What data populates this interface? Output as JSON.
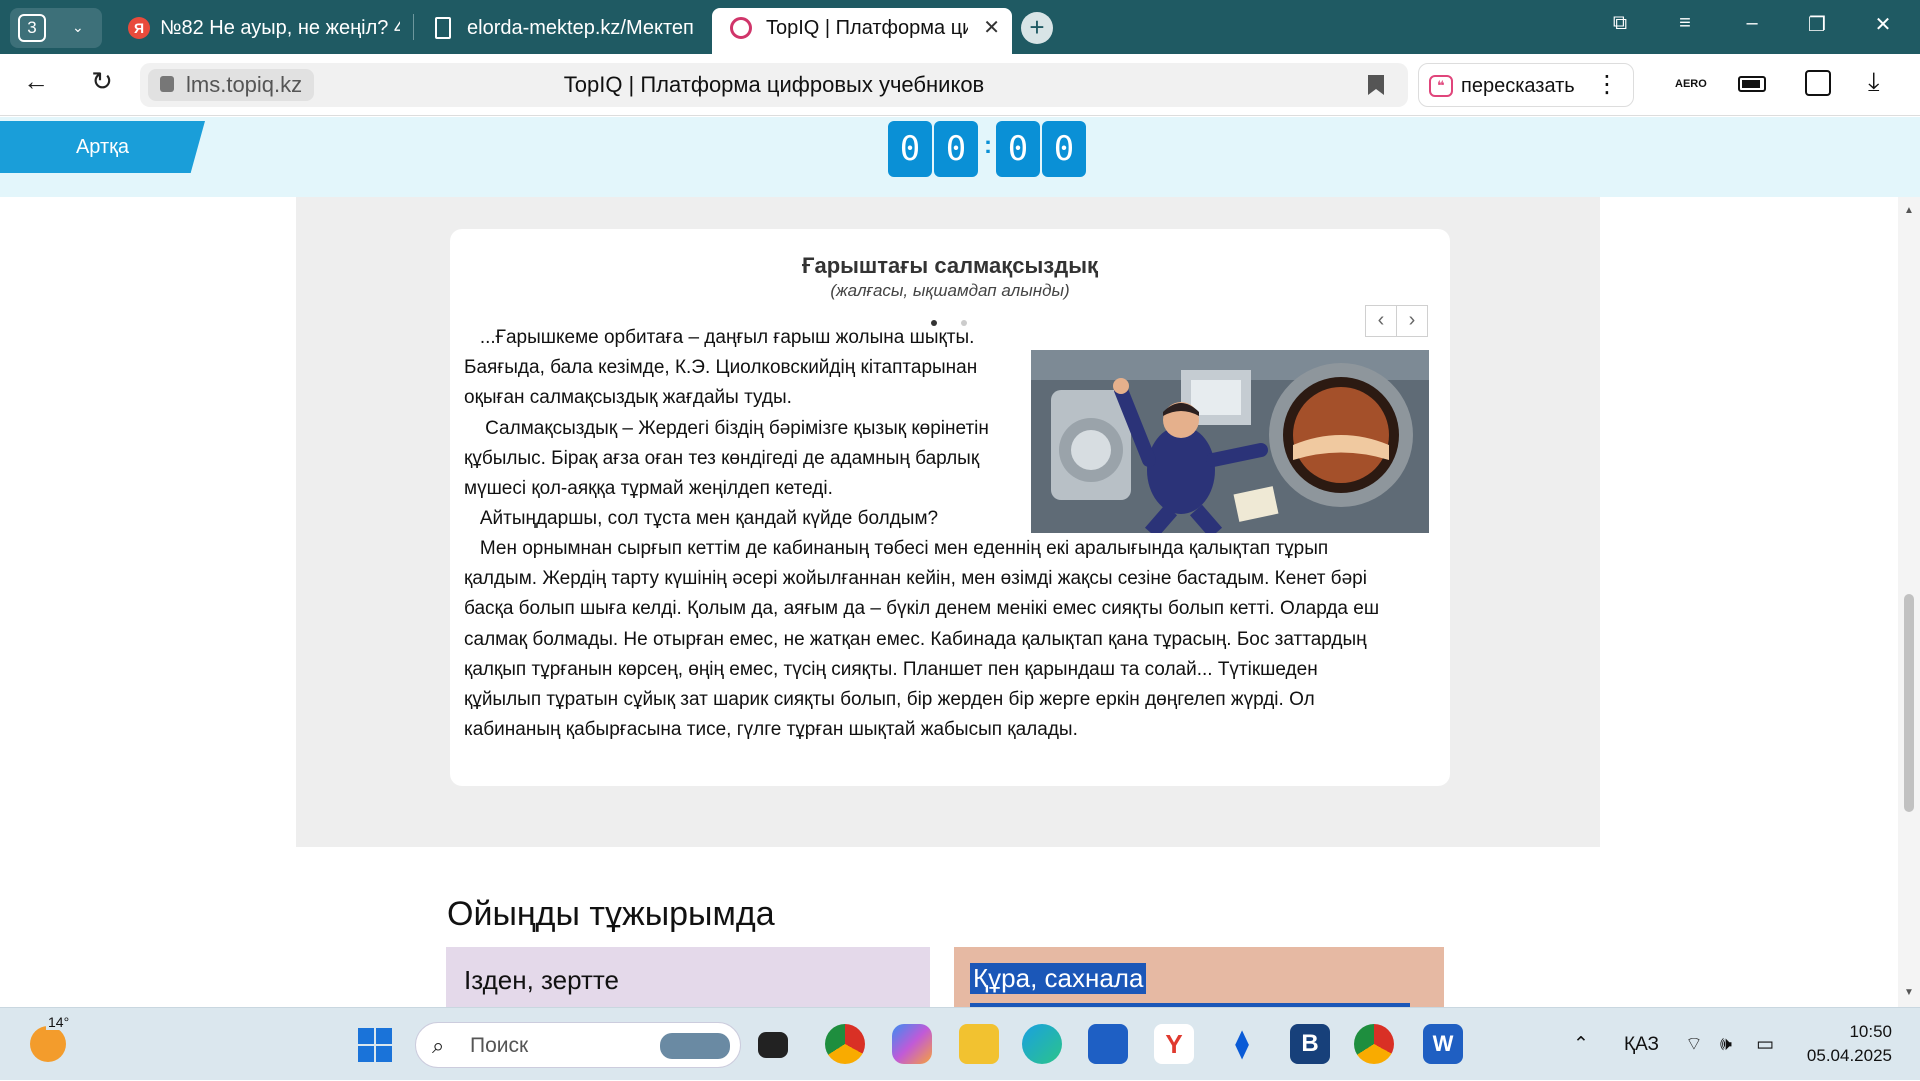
{
  "browser": {
    "tab_group_count": "3",
    "tabs": [
      {
        "label": "№82 Не ауыр, не жеңіл? 4",
        "icon": "Я"
      },
      {
        "label": "elorda-mektep.kz/Мектеп",
        "icon": ""
      },
      {
        "label": "TopIQ | Платформа циф",
        "icon": ""
      }
    ],
    "url": "lms.topiq.kz",
    "page_title": "TopIQ | Платформа цифровых учебников",
    "retell_label": "пересказать",
    "aero_label": "AERO"
  },
  "app": {
    "back_label": "Артқа",
    "timer": [
      "0",
      "0",
      "0",
      "0"
    ],
    "timer_sep": ":"
  },
  "card": {
    "title": "Ғарыштағы салмақсыздық",
    "subtitle": "(жалғасы, ықшамдап алынды)",
    "paragraph1_lines": [
      "   ...Ғарышкеме орбитаға – даңғыл ғарыш жолына шықты.",
      "Баяғыда, бала кезімде, К.Э. Циолковскийдің кітаптарынан",
      "оқыған салмақсыздық жағдайы туды."
    ],
    "paragraph2_lines": [
      "    Салмақсыздық – Жердегі біздің бәрімізге қызық көрінетін",
      "құбылыс. Бірақ ағза оған тез көндігеді де адамның барлық",
      "мүшесі қол-аяққа тұрмай жеңілдеп кетеді."
    ],
    "paragraph3_line": "   Айтыңдаршы, сол тұста мен қандай күйде болдым?",
    "paragraph4_lines": [
      "   Мен орнымнан сырғып кеттім де кабинаның төбесі мен еденнің екі аралығында қалықтап тұрып",
      "қалдым. Жердің тарту күшінің әсері жойылғаннан кейін, мен өзімді жақсы сезіне бастадым. Кенет бәрі",
      "басқа болып шыға келді. Қолым да, аяғым да – бүкіл денем менікі емес сияқты болып кетті. Оларда еш",
      "салмақ болмады. Не отырған емес, не жатқан емес. Кабинада қалықтап қана тұрасың. Бос заттардың",
      "қалқып тұрғанын көрсең, өңің емес, түсің сияқты. Планшет пен қарындаш та солай... Түтікшеден",
      "құйылып тұратын сұйық зат шарик сияқты болып, бір жерден бір жерге еркін дөңгелеп жүрді. Ол",
      "кабинаның қабырғасына тисе, гүлге тұрған шықтай жабысып қалады."
    ]
  },
  "lower": {
    "section_title": "Ойыңды тұжырымда",
    "box1_label": "Ізден, зертте",
    "box2_label": "Құра, сахнала"
  },
  "taskbar": {
    "weather_temp": "14°",
    "search_placeholder": "Поиск",
    "lang": "ҚАЗ",
    "time": "10:50",
    "date": "05.04.2025"
  },
  "colors": {
    "browser_chrome": "#1f5a63",
    "app_header": "#e3f6fb",
    "accent_blue": "#0a90d6",
    "box1": "#e4d9ea",
    "box2": "#e6b9a3"
  }
}
